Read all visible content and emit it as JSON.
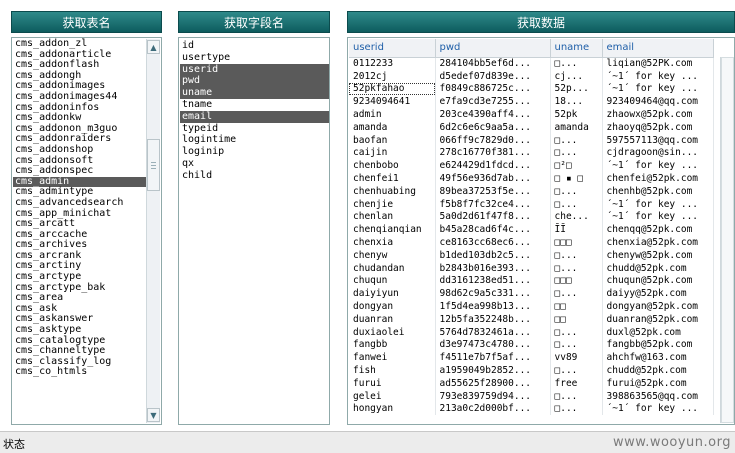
{
  "panels": {
    "tables_title": "获取表名",
    "fields_title": "获取字段名",
    "data_title": "获取数据"
  },
  "tables": [
    {
      "name": "cms_addon_zl"
    },
    {
      "name": "cms_addonarticle"
    },
    {
      "name": "cms_addonflash"
    },
    {
      "name": "cms_addongh"
    },
    {
      "name": "cms_addonimages"
    },
    {
      "name": "cms_addonimages44"
    },
    {
      "name": "cms_addoninfos"
    },
    {
      "name": "cms_addonkw"
    },
    {
      "name": "cms_addonon_m3guo"
    },
    {
      "name": "cms_addonraiders"
    },
    {
      "name": "cms_addonshop"
    },
    {
      "name": "cms_addonsoft"
    },
    {
      "name": "cms_addonspec"
    },
    {
      "name": "cms_admin",
      "selected": true
    },
    {
      "name": "cms_admintype"
    },
    {
      "name": "cms_advancedsearch"
    },
    {
      "name": "cms_app_minichat"
    },
    {
      "name": "cms_arcatt"
    },
    {
      "name": "cms_arccache"
    },
    {
      "name": "cms_archives"
    },
    {
      "name": "cms_arcrank"
    },
    {
      "name": "cms_arctiny"
    },
    {
      "name": "cms_arctype"
    },
    {
      "name": "cms_arctype_bak"
    },
    {
      "name": "cms_area"
    },
    {
      "name": "cms_ask"
    },
    {
      "name": "cms_askanswer"
    },
    {
      "name": "cms_asktype"
    },
    {
      "name": "cms_catalogtype"
    },
    {
      "name": "cms_channeltype"
    },
    {
      "name": "cms_classify_log"
    },
    {
      "name": "cms_co_htmls"
    }
  ],
  "fields": [
    {
      "name": "id"
    },
    {
      "name": "usertype"
    },
    {
      "name": "userid",
      "selected": true
    },
    {
      "name": "pwd",
      "selected": true
    },
    {
      "name": "uname",
      "selected": true
    },
    {
      "name": "tname"
    },
    {
      "name": "email",
      "selected": true
    },
    {
      "name": "typeid"
    },
    {
      "name": "logintime"
    },
    {
      "name": "loginip"
    },
    {
      "name": "qx"
    },
    {
      "name": "child"
    }
  ],
  "grid": {
    "columns": [
      "userid",
      "pwd",
      "uname",
      "email"
    ],
    "rows": [
      [
        "0112233",
        "284104bb5ef6d...",
        "□...",
        "liqian@52PK.com"
      ],
      [
        "2012cj",
        "d5edef07d839e...",
        "cj...",
        "´~1´ for key ..."
      ],
      [
        "52pkfahao",
        "f0849c886725c...",
        "52p...",
        "´~1´ for key ..."
      ],
      [
        "9234094641",
        "e7fa9cd3e7255...",
        "18...",
        "923409464@qq.com"
      ],
      [
        "admin",
        "203ce4390aff4...",
        "52pk",
        "zhaowx@52pk.com"
      ],
      [
        "amanda",
        "6d2c6e6c9aa5a...",
        "amanda",
        "zhaoyq@52pk.com"
      ],
      [
        "baofan",
        "066ff9c7829d0...",
        "□...",
        "597557113@qq.com"
      ],
      [
        "caijin",
        "278c16770f381...",
        "□...",
        "cjdragoon@sin..."
      ],
      [
        "chenbobo",
        "e624429d1fdcd...",
        "□²□",
        "´~1´ for key ..."
      ],
      [
        "chenfei1",
        "49f56e936d7ab...",
        "□ ▪ □",
        "chenfei@52pk.com"
      ],
      [
        "chenhuabing",
        "89bea37253f5e...",
        "□...",
        "chenhb@52pk.com"
      ],
      [
        "chenjie",
        "f5b8f7fc32ce4...",
        "□...",
        "´~1´ for key ..."
      ],
      [
        "chenlan",
        "5a0d2d61f47f8...",
        "che...",
        "´~1´ for key ..."
      ],
      [
        "chenqianqian",
        "b45a28cad6f4c...",
        "ĪĪ",
        "chenqq@52pk.com"
      ],
      [
        "chenxia",
        "ce8163cc68ec6...",
        "□□□",
        "chenxia@52pk.com"
      ],
      [
        "chenyw",
        "b1ded103db2c5...",
        "□...",
        "chenyw@52pk.com"
      ],
      [
        "chudandan",
        "b2843b016e393...",
        "□...",
        "chudd@52pk.com"
      ],
      [
        "chuqun",
        "dd3161238ed51...",
        "□□□",
        "chuqun@52pk.com"
      ],
      [
        "daiyiyun",
        "98d62c9a5c331...",
        "□...",
        "daiyy@52pk.com"
      ],
      [
        "dongyan",
        "1f5d4ea998b13...",
        "□□",
        "dongyan@52pk.com"
      ],
      [
        "duanran",
        "12b5fa352248b...",
        "□□",
        "duanran@52pk.com"
      ],
      [
        "duxiaolei",
        "5764d7832461a...",
        "□...",
        "duxl@52pk.com"
      ],
      [
        "fangbb",
        "d3e97473c4780...",
        "□...",
        "fangbb@52pk.com"
      ],
      [
        "fanwei",
        "f4511e7b7f5af...",
        "vv89",
        "ahchfw@163.com"
      ],
      [
        "fish",
        "a1959049b2852...",
        "□...",
        "chudd@52pk.com"
      ],
      [
        "furui",
        "ad55625f28900...",
        "free",
        "furui@52pk.com"
      ],
      [
        "gelei",
        "793e839759d94...",
        "□...",
        "398863565@qq.com"
      ],
      [
        "hongyan",
        "213a0c2d000bf...",
        "□...",
        "´~1´ for key ..."
      ]
    ]
  },
  "statusbar": {
    "label": "状态",
    "watermark": "www.wooyun.org"
  },
  "icons": {
    "up": "scroll-up-icon",
    "down": "scroll-down-icon"
  }
}
